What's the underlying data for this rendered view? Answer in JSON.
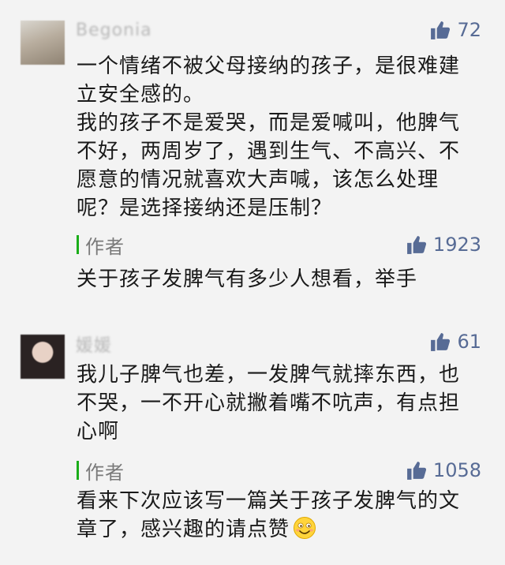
{
  "comments": [
    {
      "username": "Begonia",
      "likes": "72",
      "text": "一个情绪不被父母接纳的孩子，是很难建立安全感的。\n我的孩子不是爱哭，而是爱喊叫，他脾气不好，两周岁了，遇到生气、不高兴、不愿意的情况就喜欢大声喊，该怎么处理呢？是选择接纳还是压制？",
      "author_label": "作者",
      "author_likes": "1923",
      "reply": "关于孩子发脾气有多少人想看，举手"
    },
    {
      "username": "媛媛",
      "likes": "61",
      "text": "我儿子脾气也差，一发脾气就摔东西，也不哭，一不开心就撇着嘴不吭声，有点担心啊",
      "author_label": "作者",
      "author_likes": "1058",
      "reply": "看来下次应该写一篇关于孩子发脾气的文章了，感兴趣的请点赞",
      "reply_emoji": "smile-emoji"
    }
  ],
  "colors": {
    "like_blue": "#576b95",
    "author_green": "#1aad19",
    "text": "#1a1a1a",
    "background": "#f3f3f3"
  }
}
